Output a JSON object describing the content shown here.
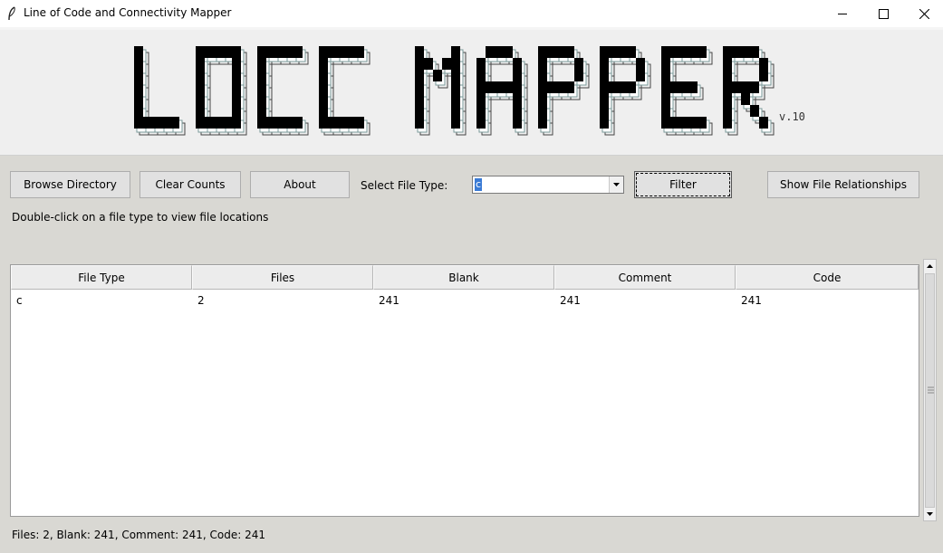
{
  "window": {
    "title": "Line of Code and Connectivity Mapper",
    "app_icon": "feather-icon"
  },
  "banner": {
    "logo_text": "LOCC MAPPER",
    "version": "v.10"
  },
  "toolbar": {
    "browse_label": "Browse Directory",
    "clear_label": "Clear Counts",
    "about_label": "About",
    "file_type_label": "Select File Type:",
    "file_type_value": "c",
    "filter_label": "Filter",
    "relationships_label": "Show File Relationships"
  },
  "hint": "Double-click on a file type to view file locations",
  "table": {
    "columns": [
      "File Type",
      "Files",
      "Blank",
      "Comment",
      "Code"
    ],
    "rows": [
      [
        "c",
        "2",
        "241",
        "241",
        "241"
      ]
    ]
  },
  "status": "Files: 2, Blank: 241, Comment: 241, Code: 241"
}
